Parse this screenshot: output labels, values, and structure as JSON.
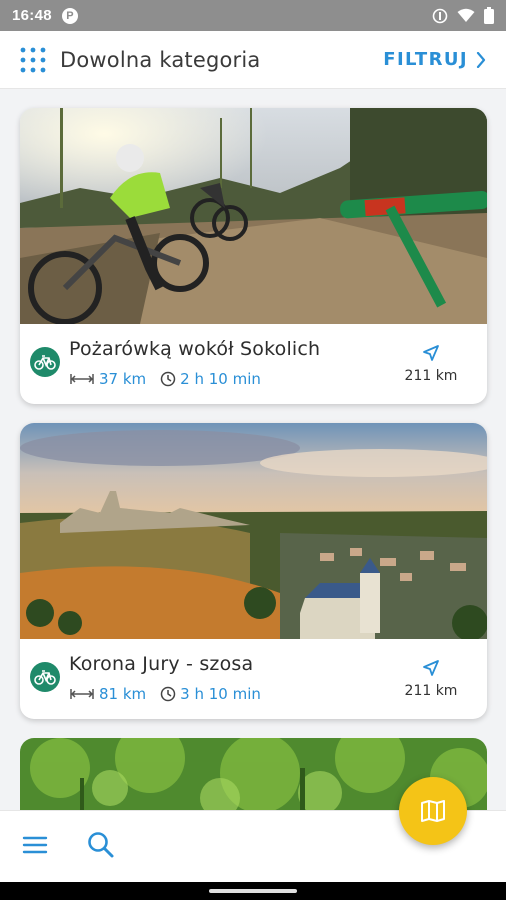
{
  "status_bar": {
    "time": "16:48",
    "notification_letter": "P",
    "icons": [
      "vibrate-icon",
      "wifi-icon",
      "battery-icon"
    ]
  },
  "app_bar": {
    "title": "Dowolna kategoria",
    "filter_label": "FILTRUJ",
    "menu_icon": "grid-dots-icon",
    "accent": "#2a8fd6"
  },
  "routes": [
    {
      "name": "Pożarówką wokół Sokolich",
      "length": "37 km",
      "duration": "2 h 10 min",
      "distance_from_user": "211 km",
      "category_icon": "bike-icon",
      "photo": "cyclists on forest gravel road"
    },
    {
      "name": "Korona Jury - szosa",
      "length": "81 km",
      "duration": "3 h 10 min",
      "distance_from_user": "211 km",
      "category_icon": "bike-icon",
      "photo": "castle ruins at sunset over town"
    }
  ],
  "bottom_bar": {
    "menu_icon": "hamburger-icon",
    "search_icon": "search-icon",
    "fab_icon": "map-icon",
    "fab_color": "#f4c417"
  }
}
